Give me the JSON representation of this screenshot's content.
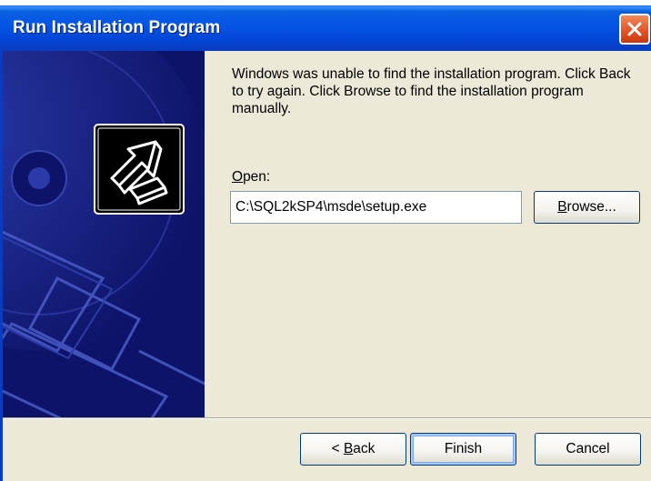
{
  "window": {
    "title": "Run Installation Program",
    "close_icon": "close-icon",
    "close_color": "#e4552b",
    "titlebar_color": "#0454e6"
  },
  "side_panel": {
    "background_color": "#0d1368",
    "icon": "setup-arrow-icon"
  },
  "main": {
    "message": "Windows was unable to find the installation program.  Click Back to try again.  Click Browse to find the installation program manually.",
    "open_label_access_key": "O",
    "open_label_rest": "pen:",
    "path_value": "C:\\SQL2kSP4\\msde\\setup.exe",
    "browse_access_key": "B",
    "browse_rest": "rowse..."
  },
  "footer": {
    "back_prefix": "< ",
    "back_access_key": "B",
    "back_rest": "ack",
    "finish_label": "Finish",
    "cancel_label": "Cancel"
  }
}
